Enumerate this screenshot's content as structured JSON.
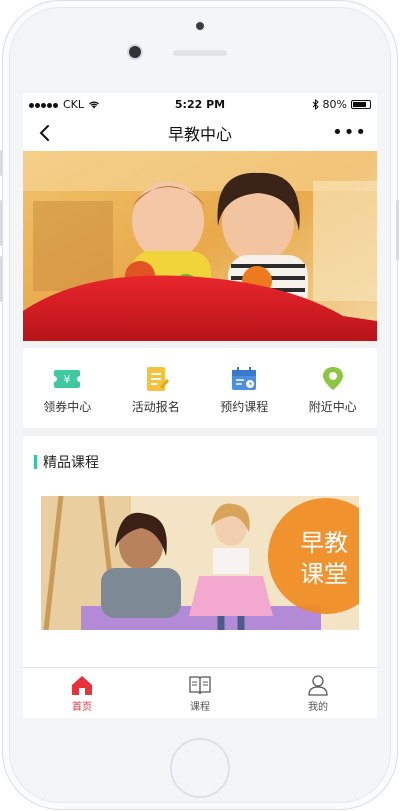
{
  "status_bar": {
    "carrier": "CKL",
    "time": "5:22 PM",
    "battery": "80%",
    "battery_level": 0.8
  },
  "nav": {
    "title": "早教中心",
    "more_label": "•••"
  },
  "quick_actions": [
    {
      "label": "领券中心",
      "icon": "coupon-icon",
      "color": "#3ec9a1"
    },
    {
      "label": "活动报名",
      "icon": "signup-icon",
      "color": "#f4c23b"
    },
    {
      "label": "预约课程",
      "icon": "calendar-icon",
      "color": "#4a8fe3"
    },
    {
      "label": "附近中心",
      "icon": "location-pin-icon",
      "color": "#8cc63f"
    }
  ],
  "featured": {
    "heading": "精品课程",
    "card_text_line1": "早教",
    "card_text_line2": "课堂"
  },
  "tabbar": [
    {
      "label": "首页",
      "icon": "home-icon",
      "active": true
    },
    {
      "label": "课程",
      "icon": "book-icon",
      "active": false
    },
    {
      "label": "我的",
      "icon": "user-icon",
      "active": false
    }
  ],
  "colors": {
    "accent_red": "#e8313d",
    "section_bar": "#2ec9a7",
    "card_badge": "#f08a1e"
  }
}
